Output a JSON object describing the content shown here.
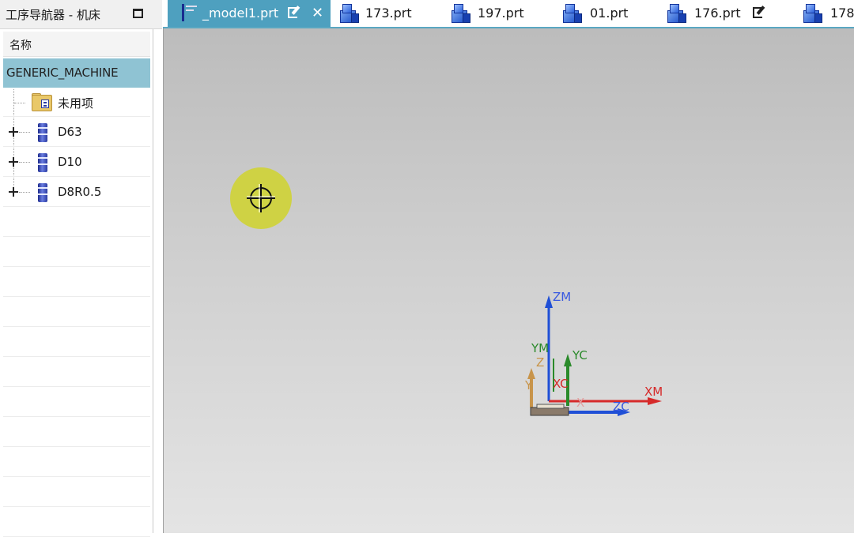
{
  "navigator": {
    "title": "工序导航器 - 机床",
    "column_header": "名称",
    "root": "GENERIC_MACHINE",
    "items": [
      {
        "label": "未用项",
        "icon": "unused-items-folder-icon",
        "expandable": false
      },
      {
        "label": "D63",
        "icon": "milling-tool-icon",
        "expandable": true
      },
      {
        "label": "D10",
        "icon": "milling-tool-icon",
        "expandable": true
      },
      {
        "label": "D8R0.5",
        "icon": "milling-tool-icon",
        "expandable": true
      }
    ]
  },
  "tabs": [
    {
      "label": "_model1.prt",
      "active": true,
      "modified": true
    },
    {
      "label": "173.prt",
      "active": false,
      "modified": false
    },
    {
      "label": "197.prt",
      "active": false,
      "modified": false
    },
    {
      "label": "01.prt",
      "active": false,
      "modified": false
    },
    {
      "label": "176.prt",
      "active": false,
      "modified": true
    },
    {
      "label": "178",
      "active": false,
      "modified": false
    }
  ],
  "close_glyph": "✕",
  "viewport": {
    "triad_labels": {
      "zm": "ZM",
      "ym": "YM",
      "yc": "YC",
      "xm": "XM",
      "zc": "ZC",
      "z": "Z",
      "xc": "XC",
      "x": "X",
      "y": "Y"
    },
    "axis_colors": {
      "z": "#1f4fd6",
      "y": "#2a8a2a",
      "x": "#d62a2a",
      "orange": "#c8944a"
    }
  }
}
